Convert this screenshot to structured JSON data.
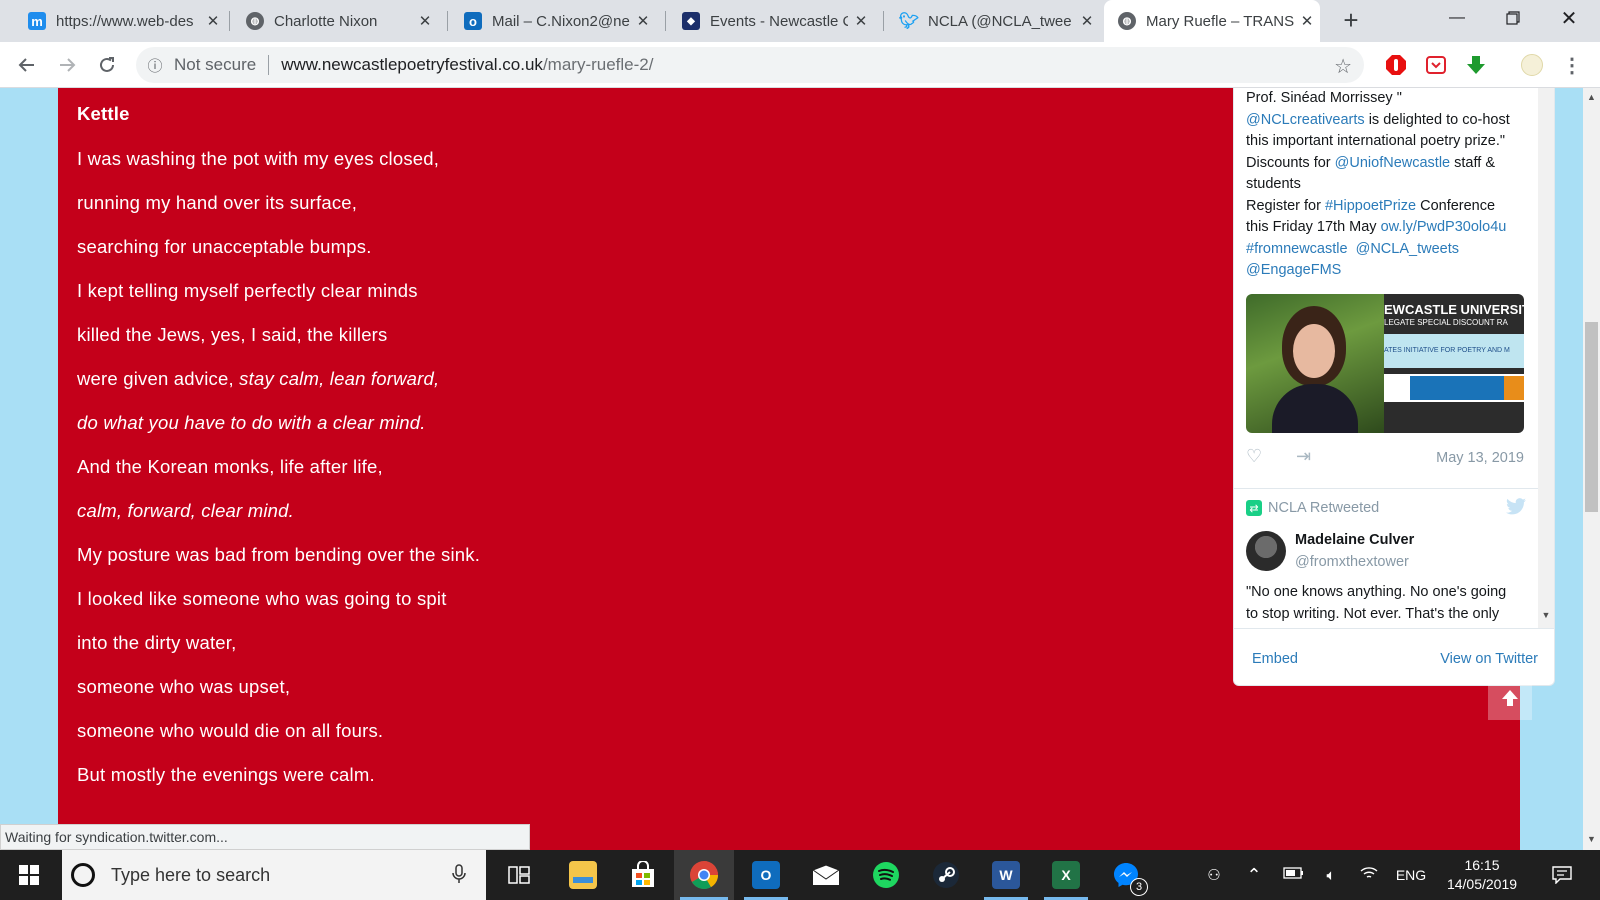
{
  "browser": {
    "tabs": [
      {
        "title": "https://www.web-des",
        "icon": "m-icon",
        "color": "#1f8ded",
        "glyph": "m"
      },
      {
        "title": "Charlotte Nixon",
        "icon": "globe-icon",
        "color": "#5f6368",
        "glyph": "◉"
      },
      {
        "title": "Mail – C.Nixon2@ne",
        "icon": "outlook-icon",
        "color": "#0f6cbd",
        "glyph": "o"
      },
      {
        "title": "Events - Newcastle C",
        "icon": "crest-icon",
        "color": "#1c2f6b",
        "glyph": "◆"
      },
      {
        "title": "NCLA (@NCLA_twee",
        "icon": "twitter-icon",
        "color": "#1da1f2",
        "glyph": "t"
      },
      {
        "title": "Mary Ruefle – TRANS",
        "icon": "globe-icon",
        "color": "#5f6368",
        "glyph": "◉"
      }
    ],
    "active_tab": 5,
    "address": {
      "security": "Not secure",
      "host": "www.newcastlepoetryfestival.co.uk",
      "path": "/mary-ruefle-2/"
    },
    "status_text": "Waiting for syndication.twitter.com..."
  },
  "poem": {
    "title": "Kettle",
    "lines": [
      {
        "text": "I was washing the pot with my eyes closed,",
        "italic_parts": []
      },
      {
        "text": "running my hand over its surface,"
      },
      {
        "text": "searching for unacceptable bumps."
      },
      {
        "text": "I kept telling myself perfectly clear minds"
      },
      {
        "text": "killed the Jews, yes, I said, the killers"
      },
      {
        "text_plain": "were given advice, ",
        "text_italic": "stay calm, lean forward,"
      },
      {
        "text_plain": "",
        "text_italic": "do what you have to do with a clear mind."
      },
      {
        "text": "And the Korean monks, life after life,"
      },
      {
        "text_plain": "",
        "text_italic": "calm, forward, clear mind."
      },
      {
        "text": "My posture was bad from bending over the sink."
      },
      {
        "text": "I looked like someone who was going to spit"
      },
      {
        "text": "into the dirty water,"
      },
      {
        "text": "someone who was upset,"
      },
      {
        "text": "someone who would die on all fours."
      },
      {
        "text": "But mostly the evenings were calm."
      }
    ]
  },
  "twitter": {
    "tweet1": {
      "l1": "Prof. Sinéad Morrissey \"",
      "l2_link": "@NCLcreativearts",
      "l2_rest": " is delighted to co-host",
      "l3": "this important international poetry prize.\"",
      "l4_a": "Discounts for ",
      "l4_link": "@UniofNewcastle",
      "l4_b": " staff &",
      "l5": "students",
      "l6_a": "Register for ",
      "l6_link": "#HippoetPrize",
      "l6_b": " Conference",
      "l7_a": "this Friday 17th May ",
      "l7_link": "ow.ly/PwdP30olo4u",
      "l8_link1": "#fromnewcastle",
      "l8_link2": "@NCLA_tweets",
      "l9_link": "@EngageFMS",
      "image_banner_1": "EWCASTLE UNIVERSIT",
      "image_banner_2": "LEGATE SPECIAL DISCOUNT RA",
      "image_banner_3": "ATES INITIATIVE FOR POETRY AND M",
      "date": "May 13, 2019"
    },
    "retweet_label": "NCLA Retweeted",
    "tweet2": {
      "name": "Madelaine Culver",
      "handle": "@fromxthextower",
      "text_l1": "\"No one knows anything. No one's going",
      "text_l2": "to stop writing. Not ever. That's the only"
    },
    "footer": {
      "embed": "Embed",
      "view": "View on Twitter"
    }
  },
  "taskbar": {
    "search_placeholder": "Type here to search",
    "language": "ENG",
    "time": "16:15",
    "date": "14/05/2019",
    "messenger_badge": "3"
  }
}
